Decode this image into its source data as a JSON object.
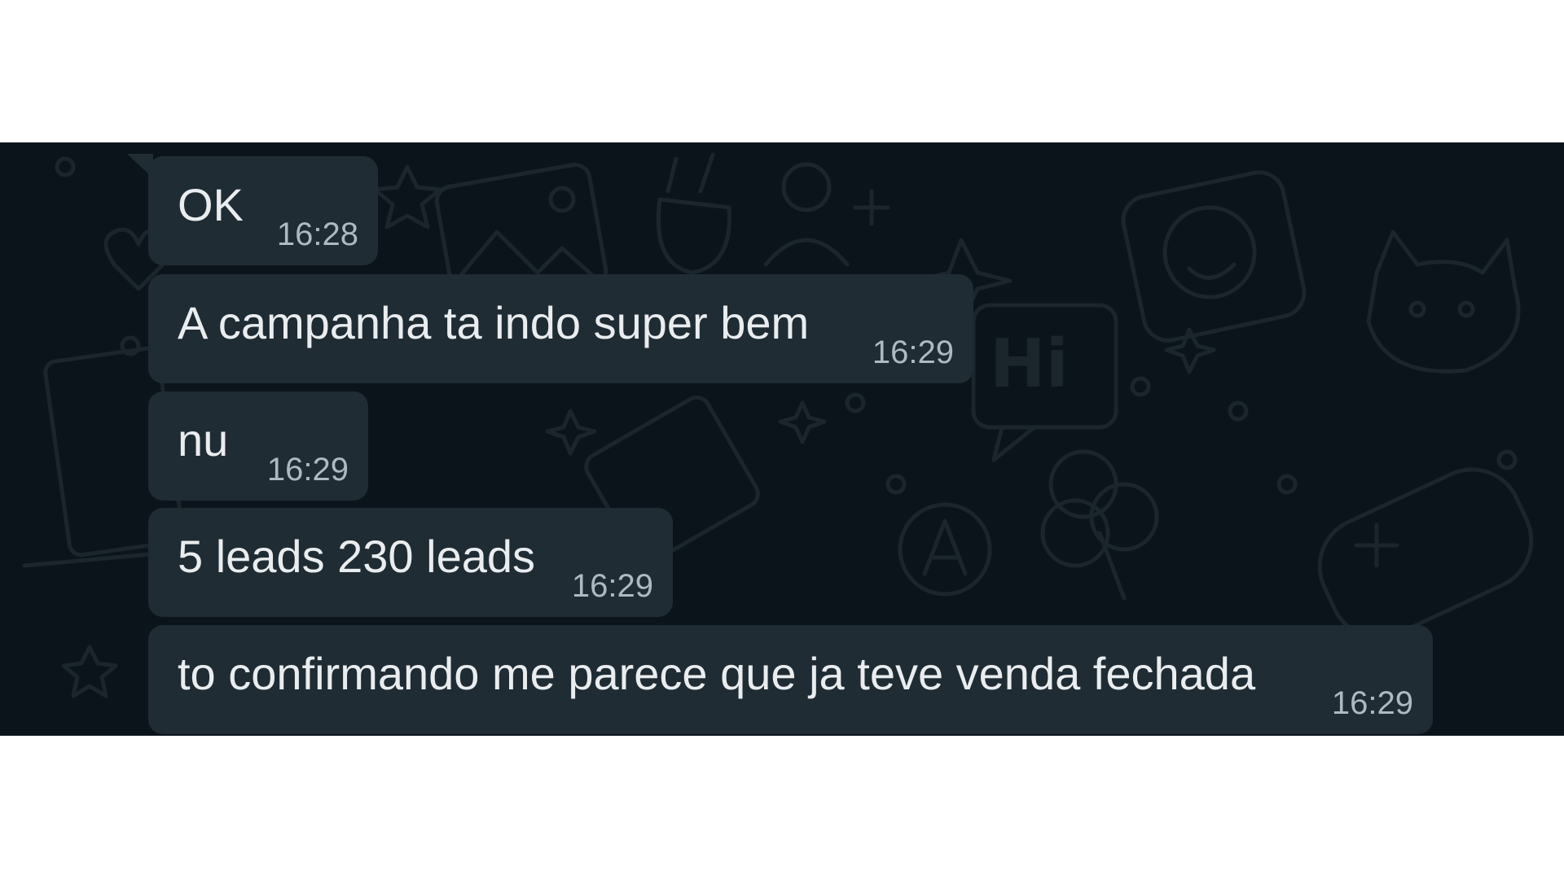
{
  "chat": {
    "messages": [
      {
        "text": "OK",
        "time": "16:28"
      },
      {
        "text": "A campanha ta indo super bem",
        "time": "16:29"
      },
      {
        "text": "nu",
        "time": "16:29"
      },
      {
        "text": "5 leads 230 leads",
        "time": "16:29"
      },
      {
        "text": "to confirmando me parece que ja teve venda fechada",
        "time": "16:29"
      }
    ],
    "background_doodle_text": "Hi"
  },
  "colors": {
    "chat_background": "#0b141a",
    "bubble_background": "#202c33",
    "message_text": "#e9edef",
    "timestamp_text": "#aebac1",
    "doodle_stroke": "#1b252c"
  }
}
